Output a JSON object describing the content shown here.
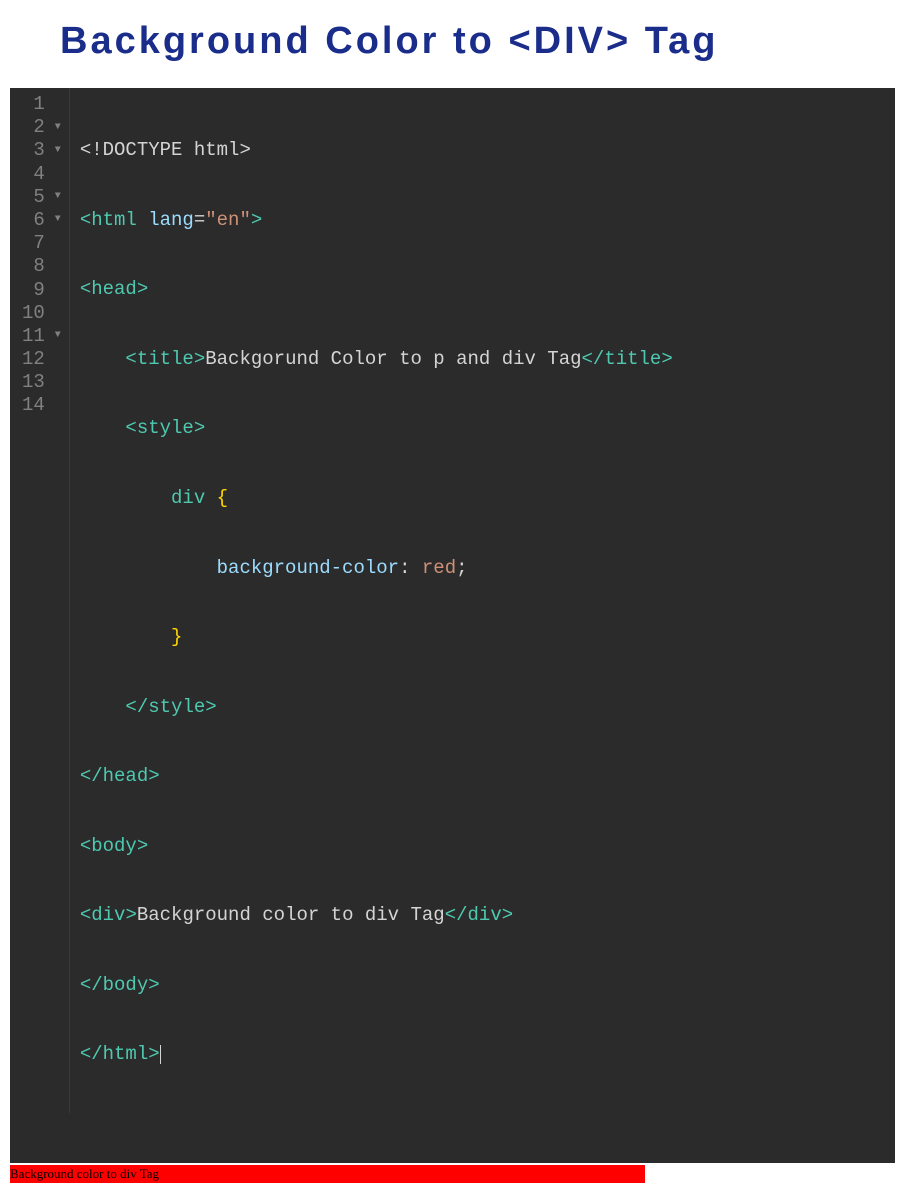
{
  "title": "Background Color to <DIV> Tag",
  "lineNumbers": [
    "1",
    "2",
    "3",
    "4",
    "5",
    "6",
    "7",
    "8",
    "9",
    "10",
    "11",
    "12",
    "13",
    "14"
  ],
  "foldable": [
    false,
    true,
    true,
    false,
    true,
    true,
    false,
    false,
    false,
    false,
    true,
    false,
    false,
    false
  ],
  "code": {
    "l1": {
      "doctype": "<!DOCTYPE html>"
    },
    "l2": {
      "open": "<",
      "tag": "html",
      "attr": " lang",
      "eq": "=",
      "str": "\"en\"",
      "close": ">"
    },
    "l3": {
      "open": "<",
      "tag": "head",
      "close": ">"
    },
    "l4": {
      "indent": "    ",
      "open": "<",
      "tag": "title",
      "close": ">",
      "text": "Backgorund Color to p and div Tag",
      "copen": "</",
      "ctag": "title",
      "cclose": ">"
    },
    "l5": {
      "indent": "    ",
      "open": "<",
      "tag": "style",
      "close": ">"
    },
    "l6": {
      "indent": "        ",
      "sel": "div",
      "brace": " {"
    },
    "l7": {
      "indent": "            ",
      "prop": "background-color",
      "colon": ": ",
      "val": "red",
      "semi": ";"
    },
    "l8": {
      "indent": "        ",
      "brace": "}"
    },
    "l9": {
      "indent": "    ",
      "open": "</",
      "tag": "style",
      "close": ">"
    },
    "l10": {
      "open": "</",
      "tag": "head",
      "close": ">"
    },
    "l11": {
      "open": "<",
      "tag": "body",
      "close": ">"
    },
    "l12": {
      "open": "<",
      "tag": "div",
      "close": ">",
      "text": "Background color to div Tag",
      "copen": "</",
      "ctag": "div",
      "cclose": ">"
    },
    "l13": {
      "open": "</",
      "tag": "body",
      "close": ">"
    },
    "l14": {
      "open": "</",
      "tag": "html",
      "close": ">"
    }
  },
  "preview": {
    "divText": "Background color to div Tag"
  }
}
